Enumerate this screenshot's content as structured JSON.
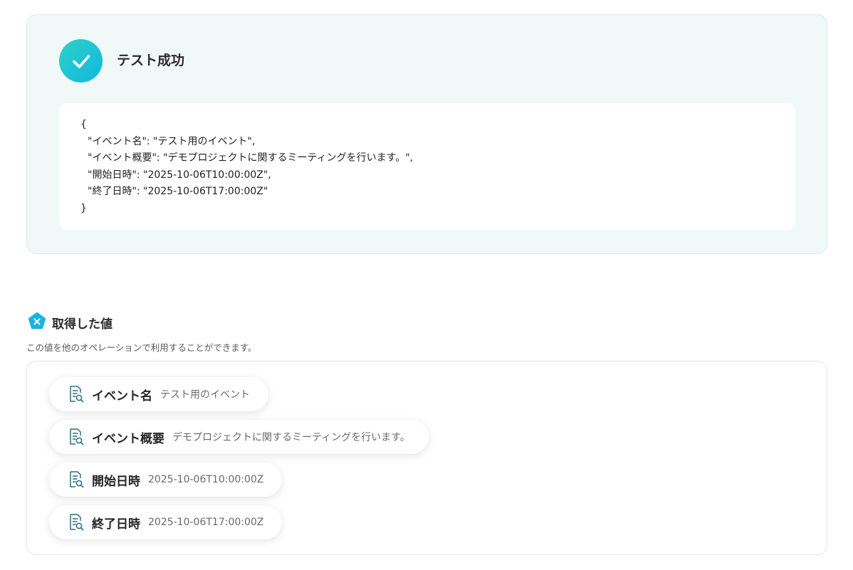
{
  "success": {
    "title": "テスト成功",
    "icon": "check-icon",
    "accent_from": "#2bd3c4",
    "accent_to": "#13b6e3",
    "json_lines": {
      "open": "{",
      "line1": "\"イベント名\": \"テスト用のイベント\",",
      "line2": "\"イベント概要\": \"デモプロジェクトに関するミーティングを行います。\",",
      "line3": "\"開始日時\": \"2025-10-06T10:00:00Z\",",
      "line4": "\"終了日時\": \"2025-10-06T17:00:00Z\"",
      "close": "}"
    }
  },
  "values": {
    "title": "取得した値",
    "icon": "pentagon-x-icon",
    "description": "この値を他のオペレーションで利用することができます。",
    "items": [
      {
        "key": "イベント名",
        "value": "テスト用のイベント",
        "icon": "document-search-icon"
      },
      {
        "key": "イベント概要",
        "value": "デモプロジェクトに関するミーティングを行います。",
        "icon": "document-search-icon"
      },
      {
        "key": "開始日時",
        "value": "2025-10-06T10:00:00Z",
        "icon": "document-search-icon"
      },
      {
        "key": "終了日時",
        "value": "2025-10-06T17:00:00Z",
        "icon": "document-search-icon"
      }
    ]
  }
}
